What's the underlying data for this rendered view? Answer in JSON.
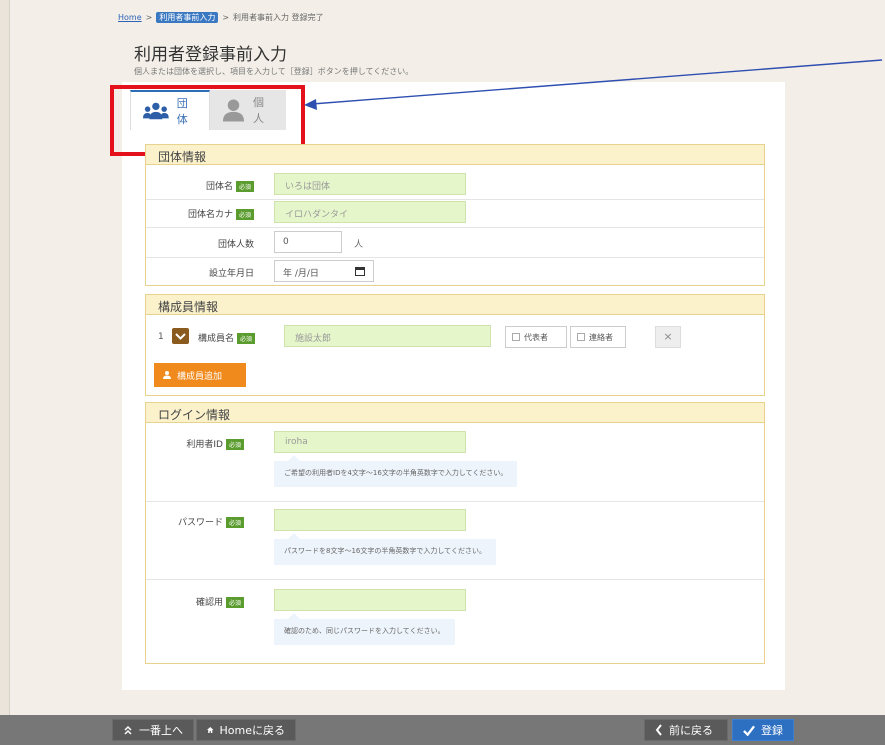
{
  "breadcrumb": {
    "home": "Home",
    "sep1": ">",
    "current": "利用者事前入力",
    "sep2": ">",
    "last": "利用者事前入力 登録完了"
  },
  "page": {
    "title": "利用者登録事前入力",
    "description": "個人または団体を選択し、項目を入力して［登録］ボタンを押してください。"
  },
  "tabs": [
    {
      "label": "団体",
      "active": true
    },
    {
      "label": "個人",
      "active": false
    }
  ],
  "required_badge": "必須",
  "group_section": {
    "header": "団体情報",
    "name_label": "団体名",
    "name_value": "いろは団体",
    "kana_label": "団体名カナ",
    "kana_value": "イロハダンタイ",
    "count_label": "団体人数",
    "count_value": "0",
    "count_unit": "人",
    "date_label": "設立年月日",
    "date_placeholder": "年 /月/日"
  },
  "member_section": {
    "header": "構成員情報",
    "row_number": "1",
    "name_label": "構成員名",
    "name_value": "施設太郎",
    "rep_label": "代表者",
    "contact_label": "連絡者",
    "remove_label": "×",
    "add_button": "構成員追加"
  },
  "login_section": {
    "header": "ログイン情報",
    "userid_label": "利用者ID",
    "userid_value": "iroha",
    "userid_hint": "ご希望の利用者IDを4文字～16文字の半角英数字で入力してください。",
    "password_label": "パスワード",
    "password_hint": "パスワードを8文字～16文字の半角英数字で入力してください。",
    "confirm_label": "確認用",
    "confirm_hint": "確認のため、同じパスワードを入力してください。"
  },
  "footer": {
    "top_label": "一番上へ",
    "home_label": "Homeに戻る",
    "back_label": "前に戻る",
    "submit_label": "登録"
  },
  "colors": {
    "highlight": "#e4101b",
    "arrow": "#2f4fb0",
    "accent_blue": "#2d6db5",
    "input_green": "#e6f6cb",
    "section_yellow": "#fbf2cc",
    "required_green": "#5b9c2f",
    "add_orange": "#f08a1c"
  }
}
